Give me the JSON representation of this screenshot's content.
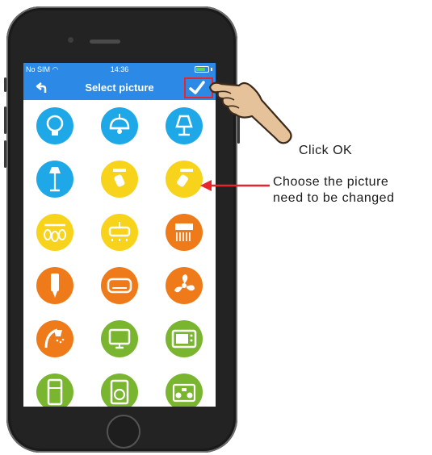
{
  "statusbar": {
    "carrier": "No SIM",
    "time": "14:36",
    "battery_level": 0.8
  },
  "navbar": {
    "title": "Select picture",
    "back_icon": "back-arrow-icon",
    "ok_icon": "checkmark-icon"
  },
  "icons": [
    {
      "name": "bulb-icon",
      "color": "#1fa8e8"
    },
    {
      "name": "pendant-lamp-icon",
      "color": "#1fa8e8"
    },
    {
      "name": "table-lamp-icon",
      "color": "#1fa8e8"
    },
    {
      "name": "floor-lamp-icon",
      "color": "#1fa8e8"
    },
    {
      "name": "spotlight-icon",
      "color": "#f7d31c"
    },
    {
      "name": "spotlight-tilted-icon",
      "color": "#f7d31c"
    },
    {
      "name": "chandelier-icon",
      "color": "#f7d31c"
    },
    {
      "name": "ceiling-light-icon",
      "color": "#f7d31c"
    },
    {
      "name": "fan-light-icon",
      "color": "#ef7a1a"
    },
    {
      "name": "fluorescent-lamp-icon",
      "color": "#ef7a1a"
    },
    {
      "name": "air-conditioner-icon",
      "color": "#ef7a1a"
    },
    {
      "name": "fan-icon",
      "color": "#ef7a1a"
    },
    {
      "name": "shower-icon",
      "color": "#ef7a1a"
    },
    {
      "name": "tv-icon",
      "color": "#79b52e"
    },
    {
      "name": "microwave-icon",
      "color": "#79b52e"
    },
    {
      "name": "fridge-icon",
      "color": "#79b52e"
    },
    {
      "name": "washing-machine-icon",
      "color": "#79b52e"
    },
    {
      "name": "stereo-icon",
      "color": "#79b52e"
    }
  ],
  "annotations": {
    "click_ok": "Click OK",
    "choose_line1": "Choose the picture",
    "choose_line2": "need to be changed"
  },
  "colors": {
    "accent": "#2c8ae6",
    "highlight": "#e8242c",
    "hand": "#e6c29a"
  }
}
